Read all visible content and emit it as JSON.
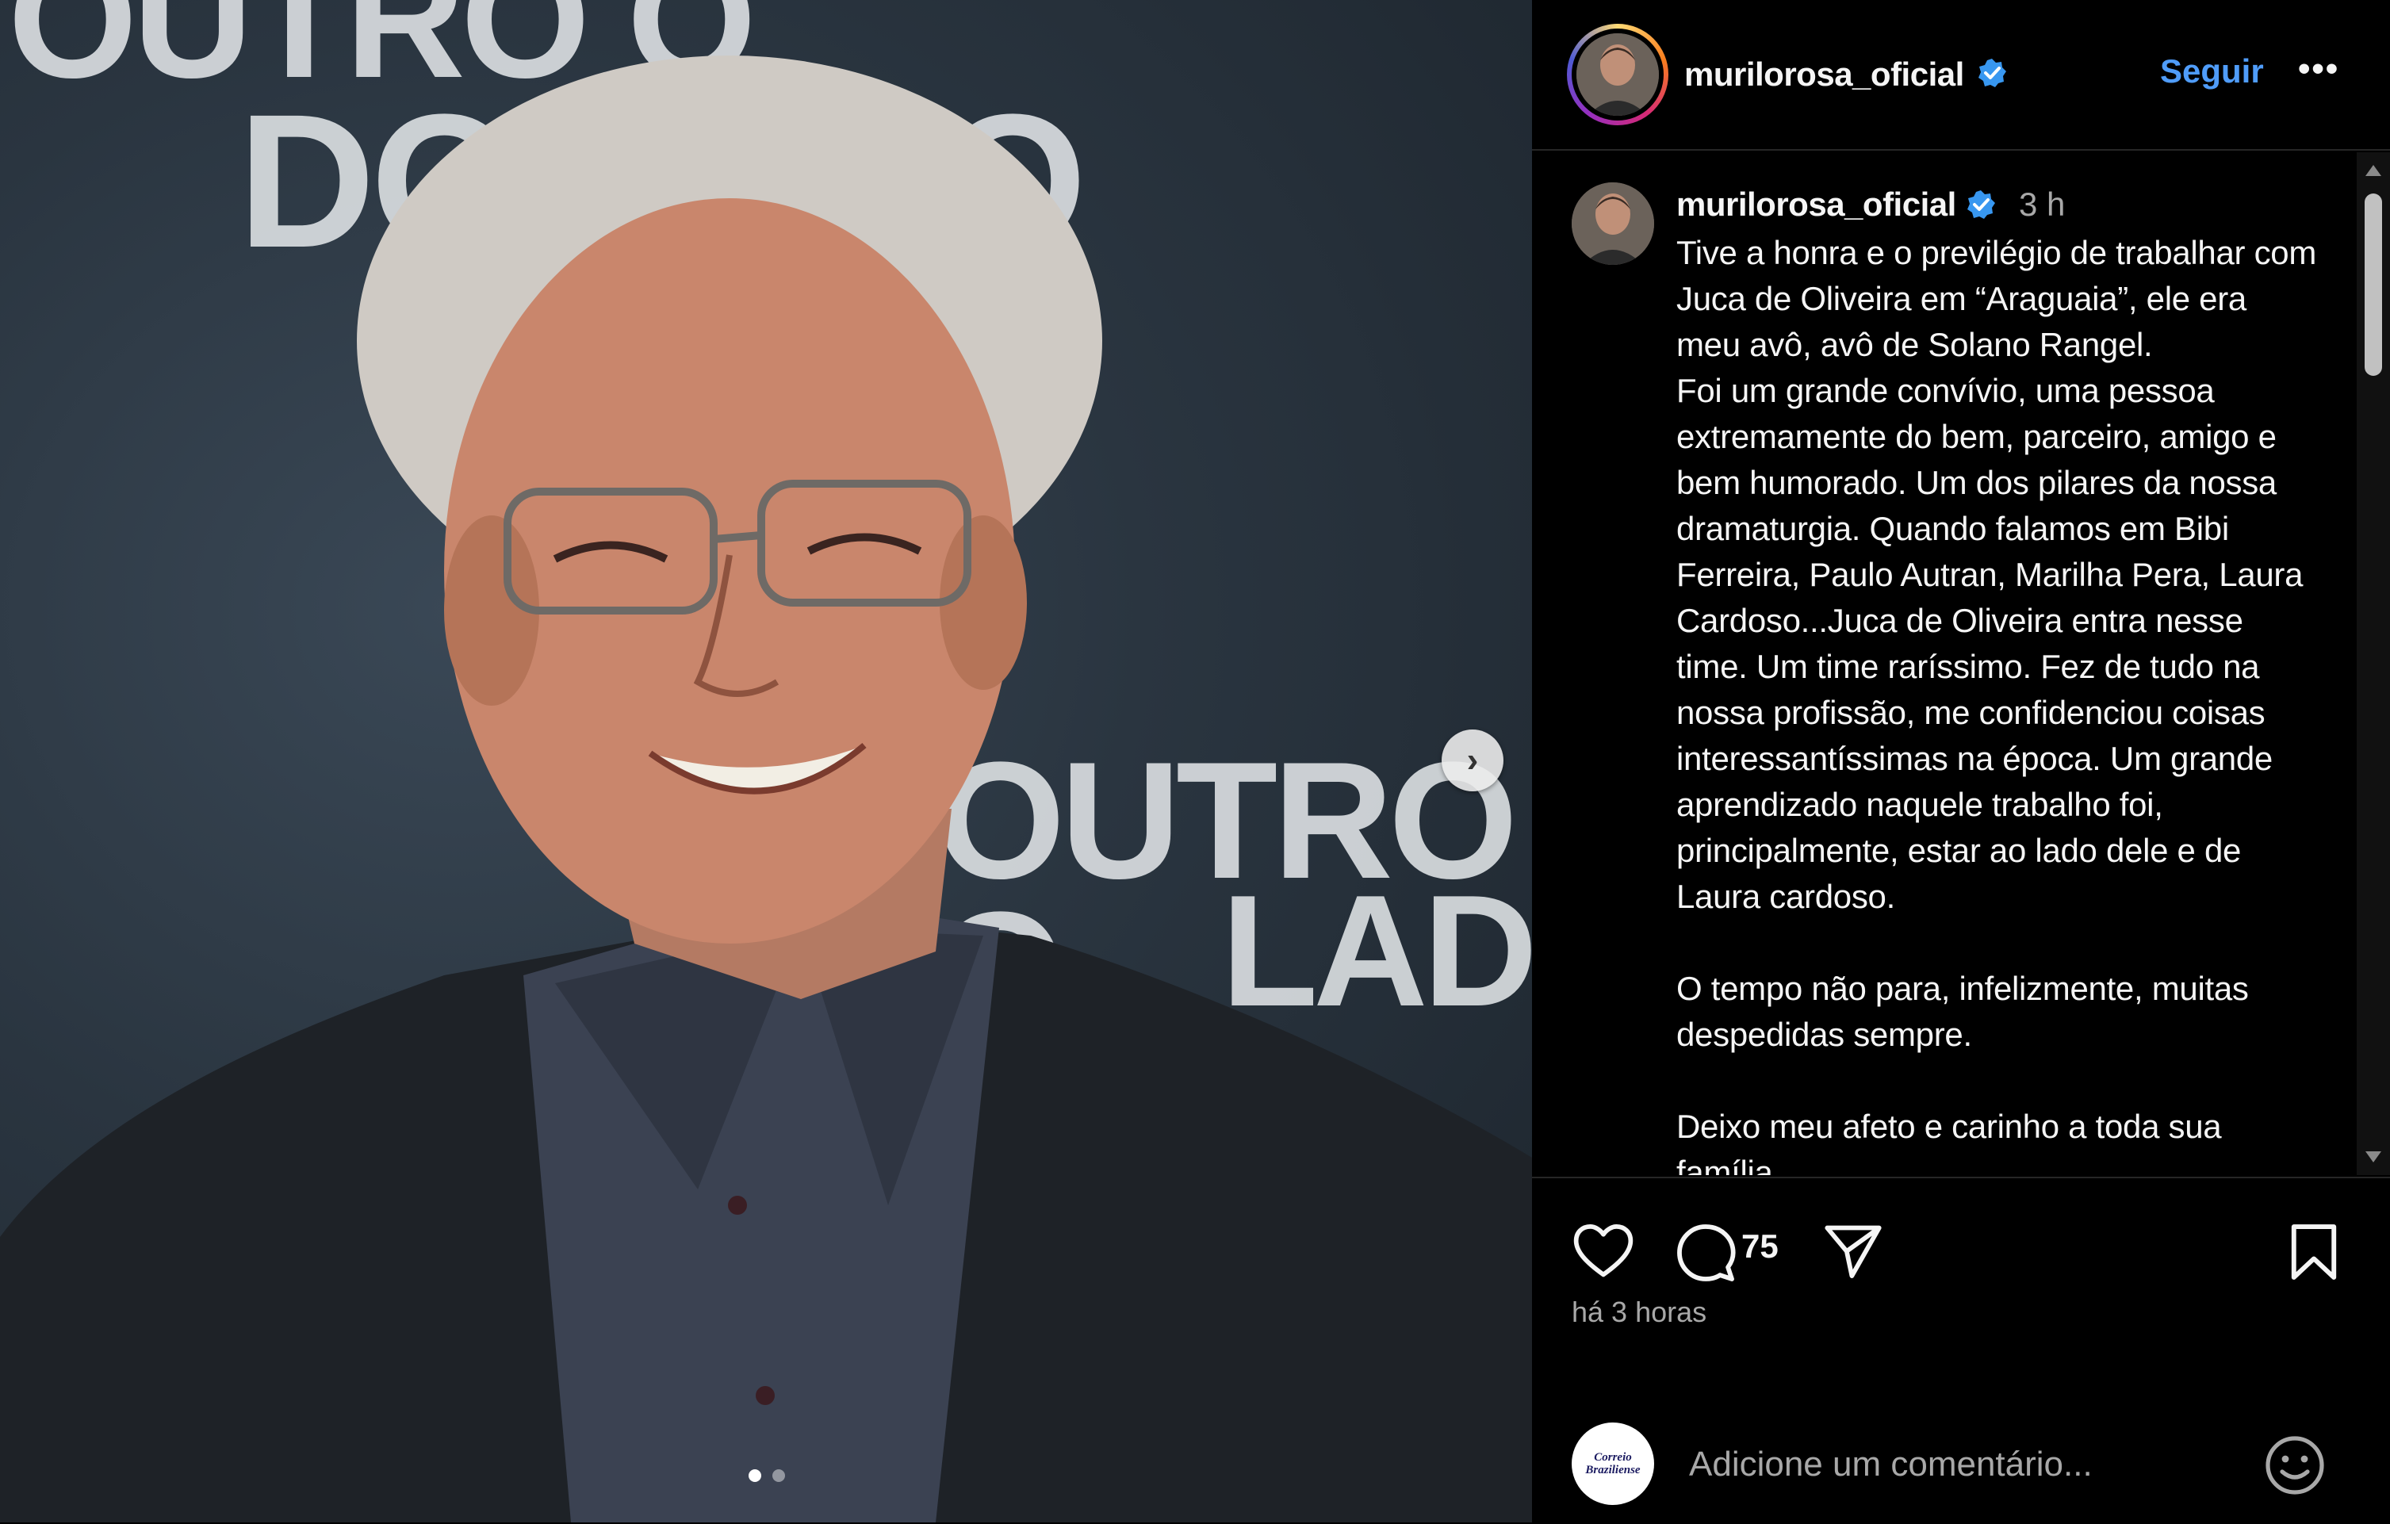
{
  "post": {
    "username": "murilorosa_oficial",
    "follow_label": "Seguir",
    "more_label": "•••",
    "caption_time": "3 h",
    "caption": "Tive a honra e o previlégio de trabalhar com Juca de Oliveira em “Araguaia”, ele era meu avô, avô de Solano Rangel.\nFoi um grande convívio, uma pessoa extremamente do bem, parceiro, amigo e bem humorado. Um dos pilares da nossa dramaturgia. Quando falamos em Bibi Ferreira, Paulo Autran, Marilha Pera, Laura Cardoso...Juca de Oliveira entra nesse time. Um time raríssimo. Fez de tudo na nossa profissão, me confidenciou coisas interessantíssimas na época. Um grande aprendizado naquele trabalho foi, principalmente, estar ao lado dele e de Laura cardoso.\n\nO tempo não para, infelizmente, muitas despedidas sempre.\n\nDeixo meu afeto e carinho a toda sua família"
  },
  "media": {
    "backdrop_text": [
      "OUTRO O",
      "DO LADO",
      "OUTRO O",
      "LADO"
    ],
    "carousel_next": "›",
    "slide_index": 1,
    "slide_count": 2
  },
  "actions": {
    "comment_count": "75",
    "time_ago": "há 3 horas"
  },
  "add_comment": {
    "placeholder": "Adicione um comentário...",
    "commenter_logo_text": [
      "Correio",
      "Braziliense"
    ]
  },
  "colors": {
    "accent_blue": "#4f9cf9",
    "verified_blue": "#3897f0",
    "background": "#000000",
    "muted_text": "#a8a8a8"
  },
  "icons": [
    "heart-icon",
    "comment-icon",
    "share-icon",
    "bookmark-icon",
    "emoji-icon",
    "verified-icon",
    "chevron-right-icon"
  ]
}
